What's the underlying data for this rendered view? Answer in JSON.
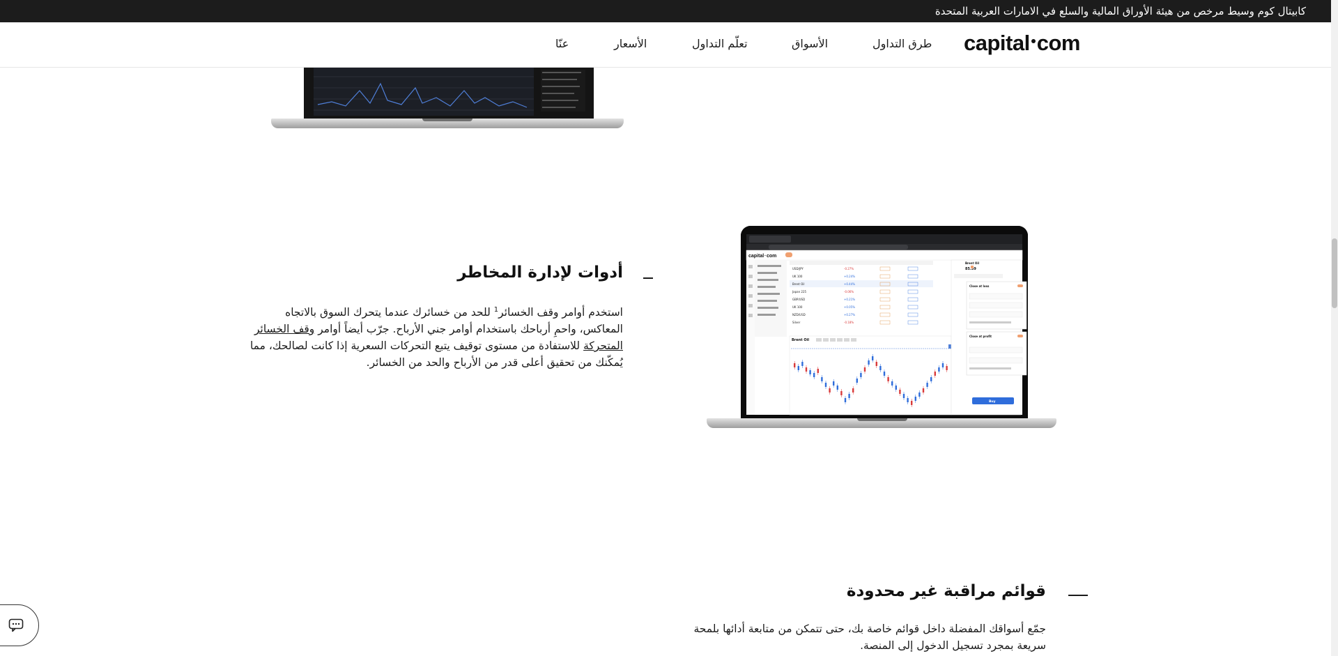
{
  "banner": {
    "text": "كابيتال كوم وسيط مرخص من هيئة الأوراق المالية والسلع في الامارات العربية المتحدة"
  },
  "header": {
    "logo_left": "capital",
    "logo_right": "com",
    "nav": [
      {
        "label": "طرق التداول"
      },
      {
        "label": "الأسواق"
      },
      {
        "label": "تعلّم التداول"
      },
      {
        "label": "الأسعار"
      },
      {
        "label": "عنّا"
      }
    ]
  },
  "risk_section": {
    "title": "أدوات لإدارة المخاطر",
    "body_1": "استخدم أوامر وقف الخسائر",
    "footnote": "1",
    "body_2": " للحد من خسائرك عندما يتحرك السوق بالاتجاه المعاكس، واحمِ أرباحك باستخدام أوامر جني الأرباح. جرّب أيضاً أوامر ",
    "link": "وقف الخسائر المتحركة",
    "body_3": " للاستفادة من مستوى توقيف يتبع التحركات السعرية إذا كانت لصالحك، مما يُمكّنك من تحقيق أعلى قدر من الأرباح والحد من الخسائر."
  },
  "watchlist_section": {
    "title": "قوائم مراقبة غير محدودة",
    "body": "جمّع أسواقك المفضلة داخل قوائم خاصة بك، حتى تتمكن من متابعة أدائها بلمحة سريعة بمجرد تسجيل الدخول إلى المنصة."
  },
  "platform_mockup": {
    "logo_left": "capital",
    "logo_right": "com",
    "chart_instrument": "Brent Oil",
    "panel_title": "Brent Oil",
    "panel_price": "85.59",
    "close_at_loss": "Close at loss",
    "close_at_profit": "Close at profit",
    "buy_label": "Buy",
    "markets": [
      {
        "name": "USD/JPY",
        "change": "-0.27%"
      },
      {
        "name": "UK 100",
        "change": "+0.24%"
      },
      {
        "name": "Brent Oil",
        "change": "+0.44%"
      },
      {
        "name": "Japan 225",
        "change": "-0.06%"
      },
      {
        "name": "GBP/USD",
        "change": "+0.21%"
      },
      {
        "name": "UK 100",
        "change": "+0.05%"
      },
      {
        "name": "NZD/USD",
        "change": "+0.27%"
      },
      {
        "name": "Silver",
        "change": "-0.18%"
      }
    ]
  },
  "icons": {
    "chat": "chat-bubble-icon"
  }
}
